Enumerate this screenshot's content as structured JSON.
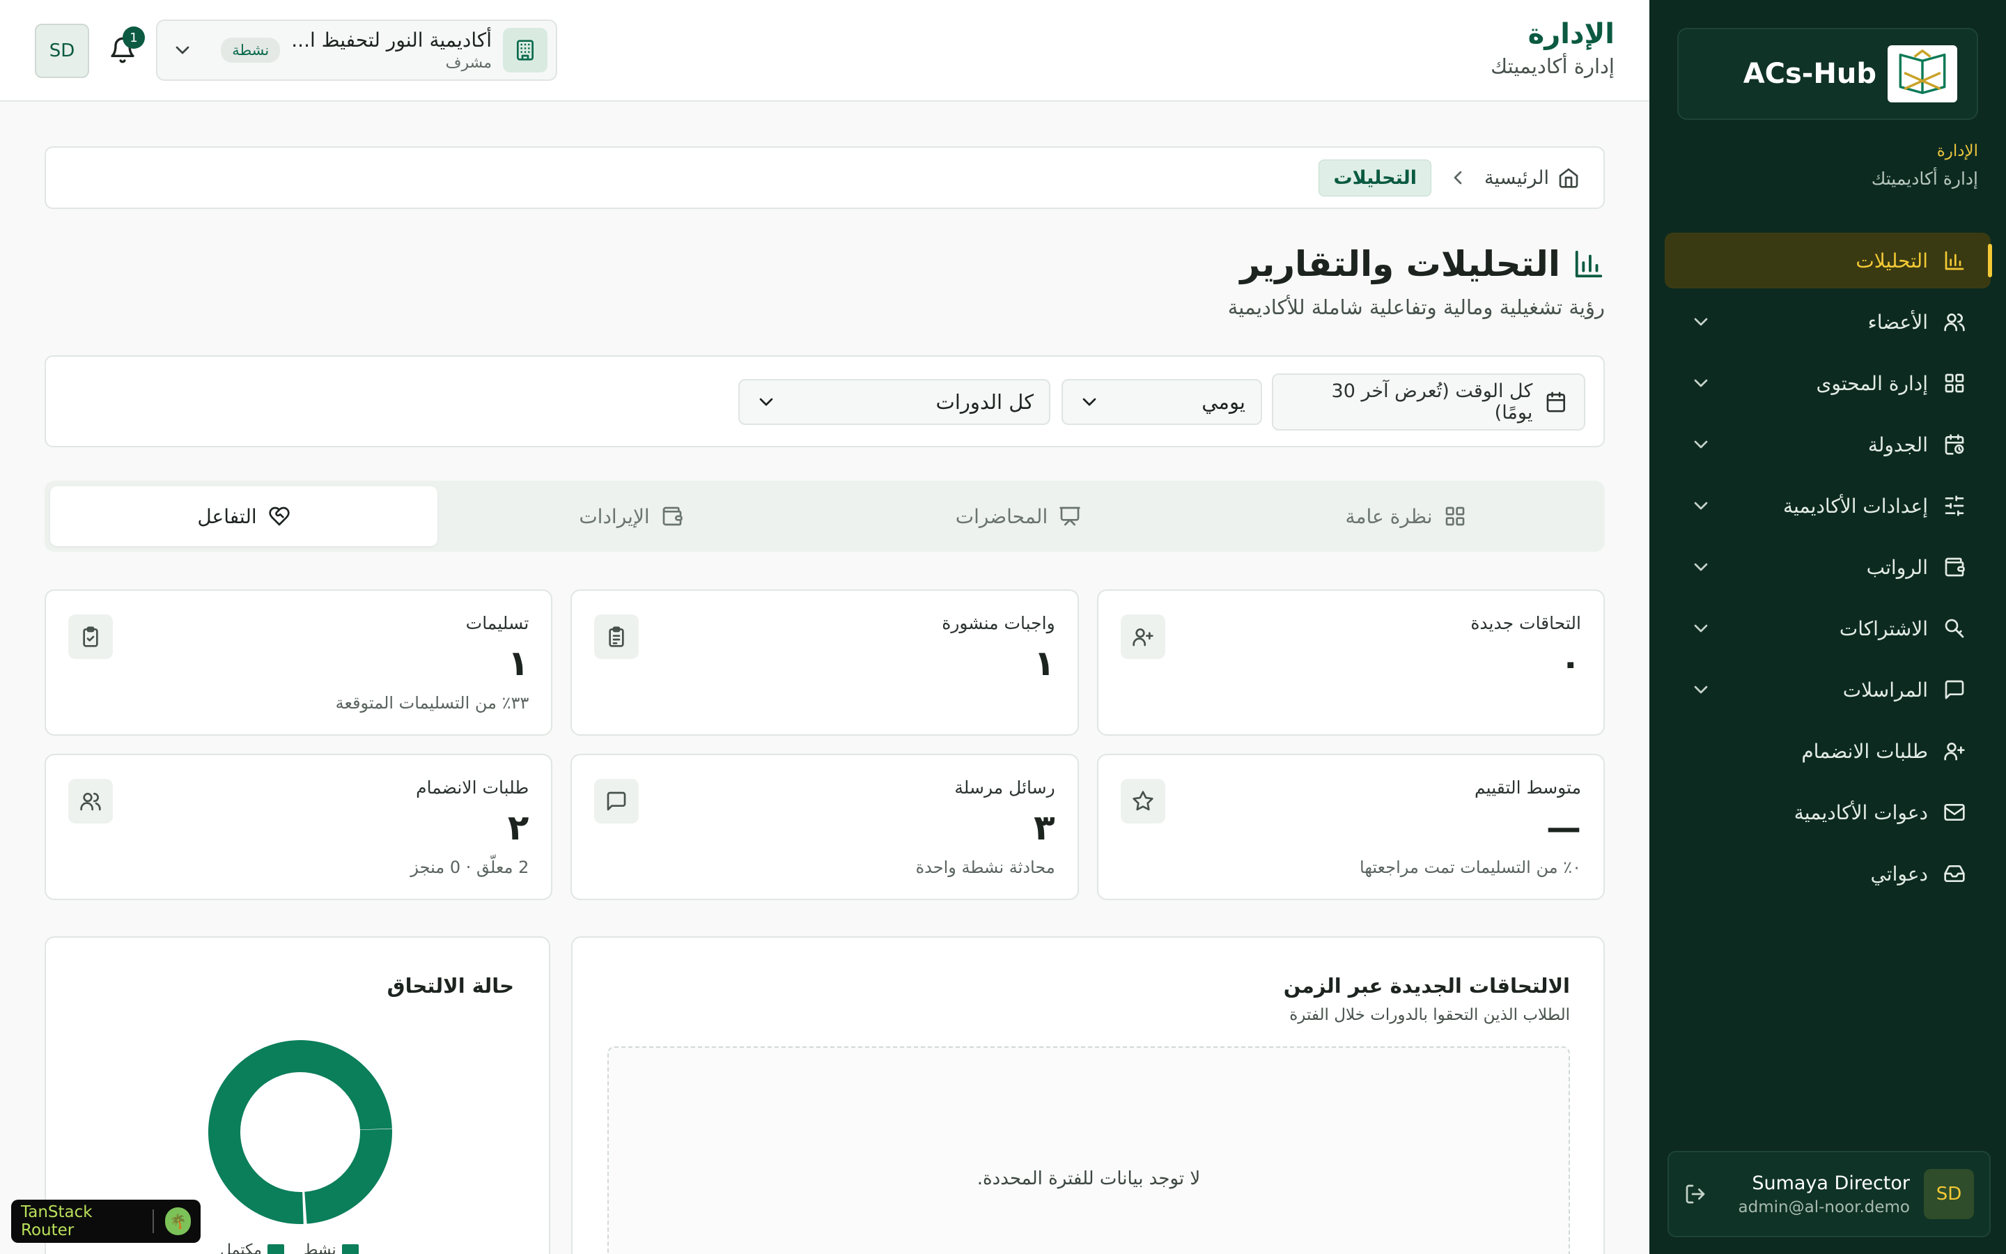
{
  "sidebar": {
    "brand_name": "ACs-Hub",
    "heading_title": "الإدارة",
    "heading_sub": "إدارة أكاديميتك",
    "items": [
      {
        "label": "التحليلات",
        "icon": "bar-chart-icon",
        "active": true
      },
      {
        "label": "الأعضاء",
        "icon": "users-icon"
      },
      {
        "label": "إدارة المحتوى",
        "icon": "grid-icon"
      },
      {
        "label": "الجدولة",
        "icon": "calendar-clock-icon"
      },
      {
        "label": "إعدادات الأكاديمية",
        "icon": "sliders-icon"
      },
      {
        "label": "الرواتب",
        "icon": "wallet-icon"
      },
      {
        "label": "الاشتراكات",
        "icon": "badge-icon"
      },
      {
        "label": "المراسلات",
        "icon": "message-icon"
      },
      {
        "label": "طلبات الانضمام",
        "icon": "user-plus-icon"
      },
      {
        "label": "دعوات الأكاديمية",
        "icon": "mail-icon"
      },
      {
        "label": "دعواتي",
        "icon": "inbox-icon"
      }
    ],
    "user": {
      "initials": "SD",
      "name": "Sumaya Director",
      "email": "admin@al-noor.demo"
    }
  },
  "topbar": {
    "title": "الإدارة",
    "subtitle": "إدارة أكاديميتك",
    "academy_name": "أكاديمية النور لتحفيظ ا...",
    "academy_role": "مشرف",
    "academy_status": "نشطة",
    "notification_count": "1",
    "avatar_initials": "SD"
  },
  "breadcrumb": {
    "home": "الرئيسية",
    "current": "التحليلات"
  },
  "page": {
    "title": "التحليلات والتقارير",
    "subtitle": "رؤية تشغيلية ومالية وتفاعلية شاملة للأكاديمية"
  },
  "filters": {
    "date_range": "كل الوقت (تُعرض آخر 30 يومًا)",
    "period": "يومي",
    "course": "كل الدورات"
  },
  "tabs": [
    {
      "label": "نظرة عامة",
      "icon": "grid-icon"
    },
    {
      "label": "المحاضرات",
      "icon": "presentation-icon"
    },
    {
      "label": "الإيرادات",
      "icon": "wallet-icon"
    },
    {
      "label": "التفاعل",
      "icon": "heart-handshake-icon",
      "active": true
    }
  ],
  "stats": [
    {
      "label": "التحاقات جديدة",
      "value": "٠",
      "sub": "",
      "icon": "user-plus-icon"
    },
    {
      "label": "واجبات منشورة",
      "value": "١",
      "sub": "",
      "icon": "clipboard-list-icon"
    },
    {
      "label": "تسليمات",
      "value": "١",
      "sub": "٣٣٪ من التسليمات المتوقعة",
      "icon": "clipboard-check-icon"
    },
    {
      "label": "متوسط التقييم",
      "value": "—",
      "sub": "٠٪ من التسليمات تمت مراجعتها",
      "icon": "star-icon"
    },
    {
      "label": "رسائل مرسلة",
      "value": "٣",
      "sub": "محادثة نشطة واحدة",
      "icon": "message-icon"
    },
    {
      "label": "طلبات الانضمام",
      "value": "٢",
      "sub": "2 معلّق · 0 منجز",
      "icon": "users-icon"
    }
  ],
  "enrollments_chart": {
    "title": "الالتحاقات الجديدة عبر الزمن",
    "subtitle": "الطلاب الذين التحقوا بالدورات خلال الفترة",
    "empty_text": "لا توجد بيانات للفترة المحددة."
  },
  "status_chart": {
    "title": "حالة الالتحاق",
    "legend": [
      "نشط",
      "مكتمل"
    ],
    "color": "#0b7e5a"
  },
  "devtools": {
    "label": "TanStack Router"
  }
}
